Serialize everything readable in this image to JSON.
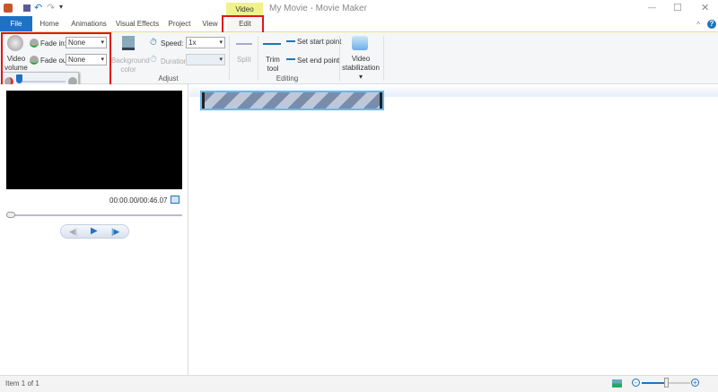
{
  "window": {
    "title": "My Movie - Movie Maker",
    "context_tab_group": "Video Tools",
    "minimize": "—",
    "maximize": "☐",
    "close": "✕",
    "help": "?",
    "collapse": "^"
  },
  "tabs": [
    "File",
    "Home",
    "Animations",
    "Visual Effects",
    "Project",
    "View",
    "Edit"
  ],
  "ribbon": {
    "audio": {
      "video_volume": "Video volume",
      "fade_in_label": "Fade in:",
      "fade_in_value": "None",
      "fade_out_label": "Fade out:",
      "fade_out_value": "None"
    },
    "adjust": {
      "background_color": "Background color",
      "speed_label": "Speed:",
      "speed_value": "1x",
      "duration_label": "Duration:",
      "duration_value": "",
      "group": "Adjust"
    },
    "editing": {
      "split": "Split",
      "trim_tool": "Trim tool",
      "set_start": "Set start point",
      "set_end": "Set end point",
      "group": "Editing"
    },
    "stabilization": {
      "label": "Video stabilization"
    }
  },
  "volume_slider": {
    "value_fraction": 0.0
  },
  "preview": {
    "time": "00:00.00/00:46.07",
    "seek_fraction": 0.0
  },
  "status": {
    "item": "Item 1 of 1",
    "zoom_fraction": 0.45
  },
  "colors": {
    "accent": "#1e72c4",
    "highlight": "#e0161e",
    "context": "#f2f28a"
  }
}
